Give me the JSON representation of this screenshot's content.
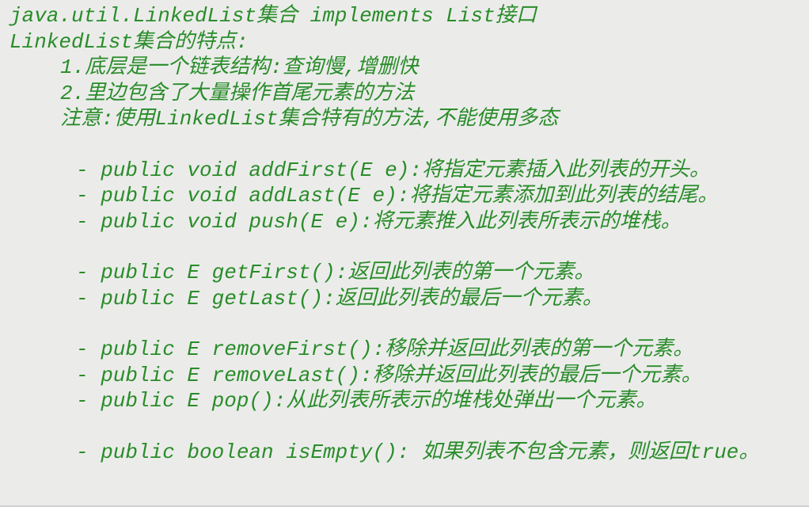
{
  "title1": "java.util.LinkedList集合 implements List接口",
  "title2": "LinkedList集合的特点:",
  "points": [
    "1.底层是一个链表结构:查询慢,增删快",
    "2.里边包含了大量操作首尾元素的方法",
    "注意:使用LinkedList集合特有的方法,不能使用多态"
  ],
  "methods1": [
    "- public void addFirst(E e):将指定元素插入此列表的开头。",
    "- public void addLast(E e):将指定元素添加到此列表的结尾。",
    "- public void push(E e):将元素推入此列表所表示的堆栈。"
  ],
  "methods2": [
    "- public E getFirst():返回此列表的第一个元素。",
    "- public E getLast():返回此列表的最后一个元素。"
  ],
  "methods3": [
    "- public E removeFirst():移除并返回此列表的第一个元素。",
    "- public E removeLast():移除并返回此列表的最后一个元素。",
    "- public E pop():从此列表所表示的堆栈处弹出一个元素。"
  ],
  "methods4": [
    "- public boolean isEmpty(): 如果列表不包含元素，则返回true。"
  ]
}
